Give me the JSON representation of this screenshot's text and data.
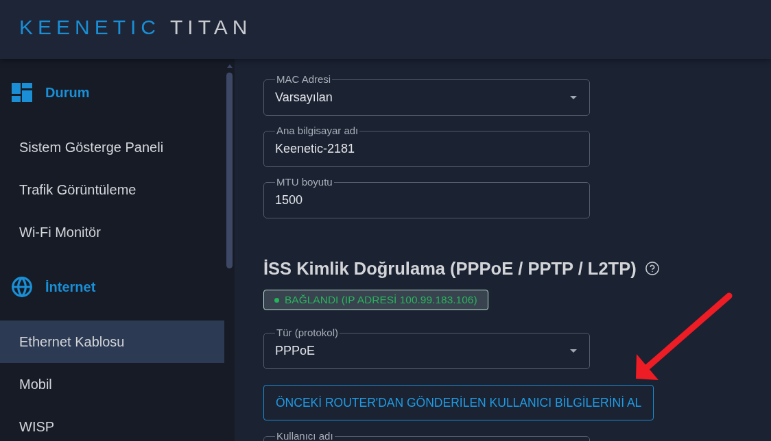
{
  "header": {
    "brand": "KEENETIC",
    "model": "TITAN"
  },
  "sidebar": {
    "groups": [
      {
        "title": "Durum",
        "items": [
          {
            "label": "Sistem Gösterge Paneli",
            "selected": false
          },
          {
            "label": "Trafik Görüntüleme",
            "selected": false
          },
          {
            "label": "Wi-Fi Monitör",
            "selected": false
          }
        ]
      },
      {
        "title": "İnternet",
        "items": [
          {
            "label": "Ethernet Kablosu",
            "selected": true
          },
          {
            "label": "Mobil",
            "selected": false
          },
          {
            "label": "WISP",
            "selected": false
          }
        ]
      }
    ]
  },
  "main": {
    "fields": [
      {
        "kind": "select",
        "label": "MAC Adresi",
        "value": "Varsayılan"
      },
      {
        "kind": "text",
        "label": "Ana bilgisayar adı",
        "value": "Keenetic-2181"
      },
      {
        "kind": "text",
        "label": "MTU boyutu",
        "value": "1500"
      }
    ],
    "isp_section": {
      "title": "İSS Kimlik Doğrulama (PPPoE / PPTP / L2TP)",
      "status": {
        "connected": true,
        "text": "BAĞLANDI (IP ADRESİ 100.99.183.106)"
      },
      "protocol_field": {
        "kind": "select",
        "label": "Tür (protokol)",
        "value": "PPPoE"
      },
      "import_button": "ÖNCEKİ ROUTER'DAN GÖNDERİLEN KULLANICI BİLGİLERİNİ AL",
      "fields": [
        {
          "label": "Kullanıcı adı"
        }
      ]
    }
  }
}
